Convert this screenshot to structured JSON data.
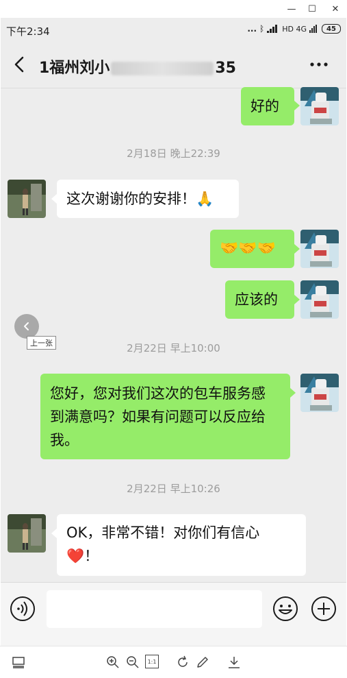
{
  "window": {
    "minimize_glyph": "—",
    "maximize_glyph": "☐",
    "close_glyph": "✕"
  },
  "status_bar": {
    "time": "下午2:34",
    "dots": "...",
    "bluetooth_glyph": "ᛒ",
    "signal_text": "HD 4G",
    "battery": "45"
  },
  "header": {
    "title_prefix": "1福州刘小",
    "title_suffix": "35",
    "back_icon": "chevron-left-icon",
    "more_icon": "more-dots-icon"
  },
  "messages": [
    {
      "side": "right",
      "text": "好的"
    },
    {
      "timestamp": "2月18日 晚上22:39"
    },
    {
      "side": "left",
      "text": "这次谢谢你的安排！🙏"
    },
    {
      "side": "right",
      "text": "🤝🤝🤝"
    },
    {
      "side": "right",
      "text": "应该的"
    },
    {
      "timestamp": "2月22日 早上10:00"
    },
    {
      "side": "right",
      "text": "您好，您对我们这次的包车服务感到满意吗？如果有问题可以反应给我。"
    },
    {
      "timestamp": "2月22日 早上10:26"
    },
    {
      "side": "left",
      "text": "OK，非常不错！对你们有信心❤️！"
    }
  ],
  "text": {
    "msg1": "好的",
    "ts1": "2月18日 晚上22:39",
    "msg2": "这次谢谢你的安排！",
    "msg2_emoji": "🙏",
    "msg3": "🤝🤝🤝",
    "msg4": "应该的",
    "ts2": "2月22日 早上10:00",
    "msg5_line1": "您好，您对我们这次的包车服务感",
    "msg5_line2": "到满意吗？如果有问题可以反应给",
    "msg5_line3": "我。",
    "ts3": "2月22日 早上10:26",
    "msg6_line1": "OK，非常不错！对你们有信心",
    "msg6_line2_heart": "❤️",
    "msg6_line2_end": "！"
  },
  "overlay": {
    "prev_label": "上一张",
    "prev_icon": "chevron-left-icon"
  },
  "input_bar": {
    "voice_icon": "voice-icon",
    "emoji_icon": "emoji-icon",
    "plus_icon": "plus-icon"
  },
  "viewer_toolbar": {
    "icons": [
      "thumbnail-icon",
      "zoom-in-icon",
      "zoom-out-icon",
      "actual-size-icon",
      "rotate-icon",
      "edit-icon",
      "download-icon"
    ],
    "actual_size_label": "1:1"
  },
  "colors": {
    "chat_bg": "#ededed",
    "green_bubble": "#95ec69",
    "white_bubble": "#ffffff",
    "timestamp": "#9c9c9c"
  }
}
